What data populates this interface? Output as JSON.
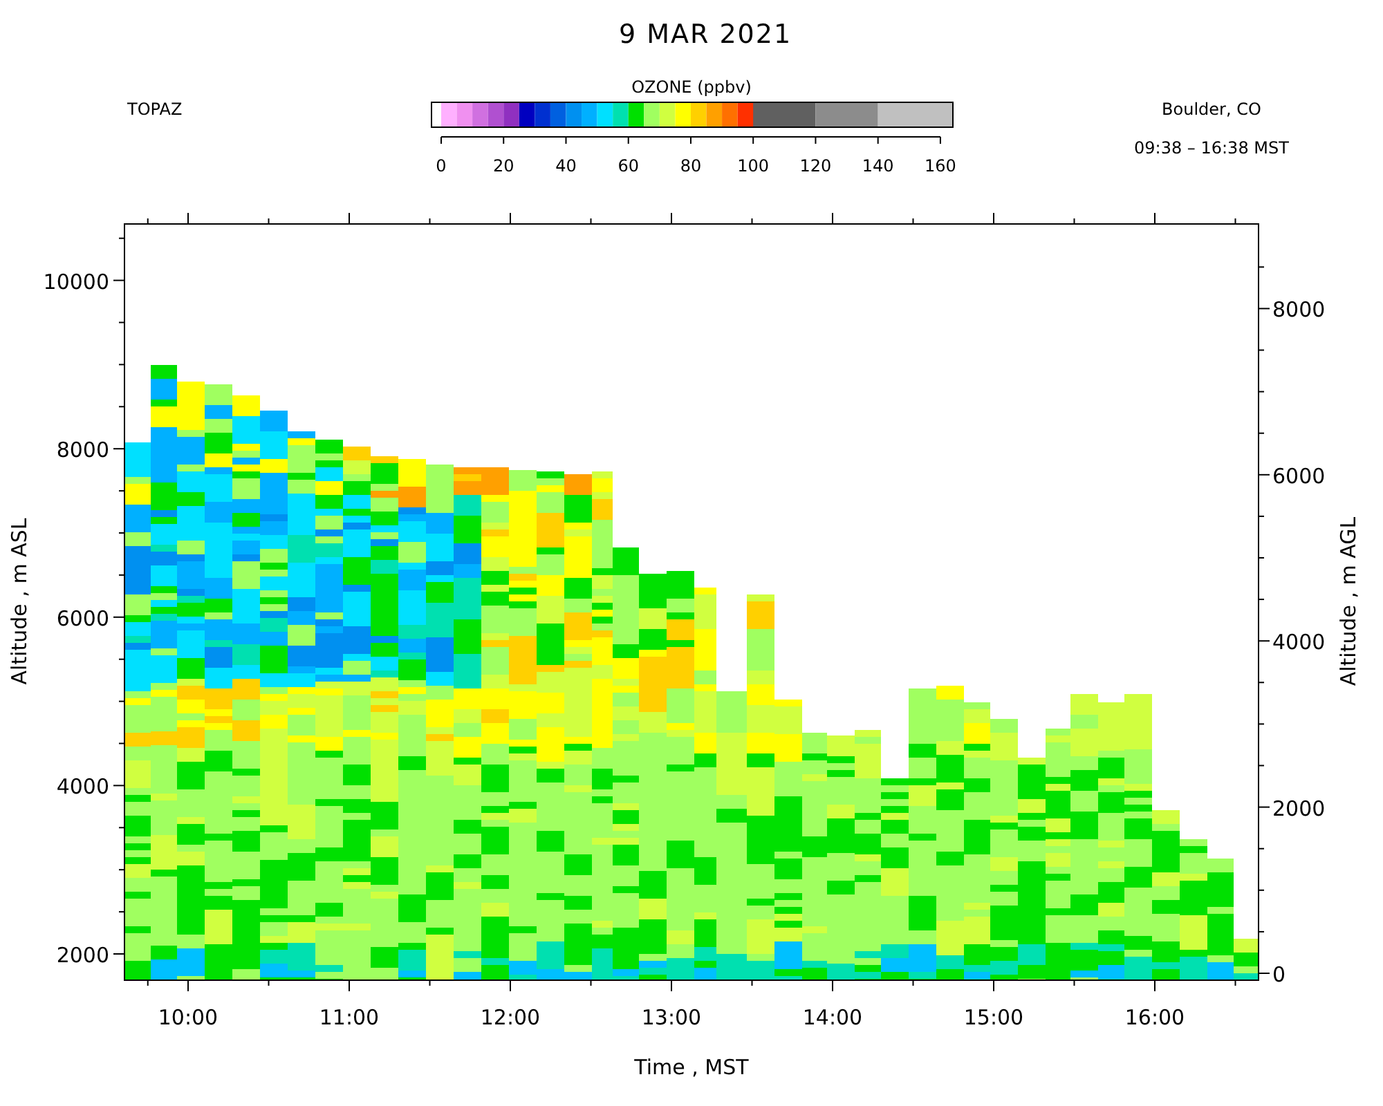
{
  "title": "9 MAR 2021",
  "station": "TOPAZ",
  "location": "Boulder, CO",
  "time_range": "09:38 – 16:38 MST",
  "colorbar": {
    "title": "OZONE (ppbv)",
    "ticks": [
      "0",
      "20",
      "40",
      "60",
      "80",
      "100",
      "120",
      "140",
      "160"
    ]
  },
  "plot": {
    "y_left_label": "Altitude , m ASL",
    "y_left_ticks": [
      "10000",
      "8000",
      "6000",
      "4000",
      "2000"
    ],
    "y_right_label": "Altitude , m AGL",
    "y_right_ticks": [
      "8000",
      "6000",
      "4000",
      "2000",
      "0"
    ],
    "x_label": "Time , MST",
    "x_ticks": [
      "10:00",
      "11:00",
      "12:00",
      "13:00",
      "14:00",
      "15:00",
      "16:00"
    ]
  }
}
